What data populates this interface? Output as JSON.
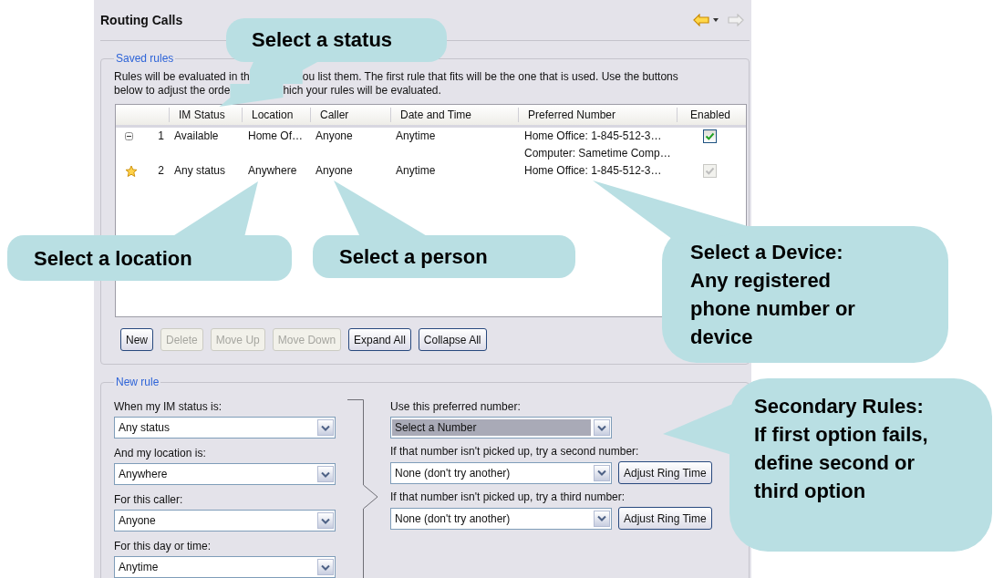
{
  "window": {
    "title": "Routing Calls",
    "back_disabled": false,
    "forward_disabled": true
  },
  "saved_rules": {
    "legend": "Saved rules",
    "description_lines": [
      [
        "Rules will be evaluated in th",
        "ou list them. The first rule that fits will be the one that is used. Use the buttons"
      ],
      [
        "below to adjust the orde",
        "hich your rules will be evaluated."
      ]
    ],
    "table": {
      "columns": [
        "IM Status",
        "Location",
        "Caller",
        "Date and Time",
        "Preferred Number",
        "Enabled"
      ],
      "rows": [
        {
          "kind": "group",
          "expanded": true,
          "number": "1",
          "im_status": "Available",
          "location": "Home Of…",
          "caller": "Anyone",
          "date_time": "Anytime",
          "preferred_numbers": [
            "Home Office: 1-845-512-3…",
            "Computer: Sametime Comp…"
          ],
          "enabled": true,
          "disabled": false
        },
        {
          "kind": "default",
          "number": "2",
          "im_status": "Any status",
          "location": "Anywhere",
          "caller": "Anyone",
          "date_time": "Anytime",
          "preferred_numbers": [
            "Home Office: 1-845-512-3…"
          ],
          "enabled": true,
          "disabled": true
        }
      ]
    },
    "buttons": [
      {
        "label": "New",
        "disabled": false
      },
      {
        "label": "Delete",
        "disabled": true
      },
      {
        "label": "Move Up",
        "disabled": true
      },
      {
        "label": "Move Down",
        "disabled": true
      },
      {
        "label": "Expand All",
        "disabled": false
      },
      {
        "label": "Collapse All",
        "disabled": false
      }
    ]
  },
  "new_rule": {
    "legend": "New rule",
    "conditions": [
      {
        "label": "When my IM status is:",
        "value": "Any status"
      },
      {
        "label": "And my location is:",
        "value": "Anywhere"
      },
      {
        "label": "For this caller:",
        "value": "Anyone"
      },
      {
        "label": "For this day or time:",
        "value": "Anytime"
      }
    ],
    "actions": [
      {
        "label": "Use this preferred number:",
        "value": "Select a Number",
        "focused": true
      },
      {
        "label": "If that number isn't picked up, try a second number:",
        "value": "None (don't try another)",
        "focused": false,
        "button": "Adjust Ring Time"
      },
      {
        "label": "If that number isn't picked up, try a third number:",
        "value": "None (don't try another)",
        "focused": false,
        "button": "Adjust Ring Time"
      }
    ]
  },
  "callouts": [
    {
      "text": "Select a status"
    },
    {
      "text": "Select a location"
    },
    {
      "text": "Select a person"
    },
    {
      "text": "Select a Device:\nAny registered\nphone number or\ndevice"
    },
    {
      "text": "Secondary Rules:\nIf first option fails,\ndefine second or\nthird option"
    }
  ]
}
